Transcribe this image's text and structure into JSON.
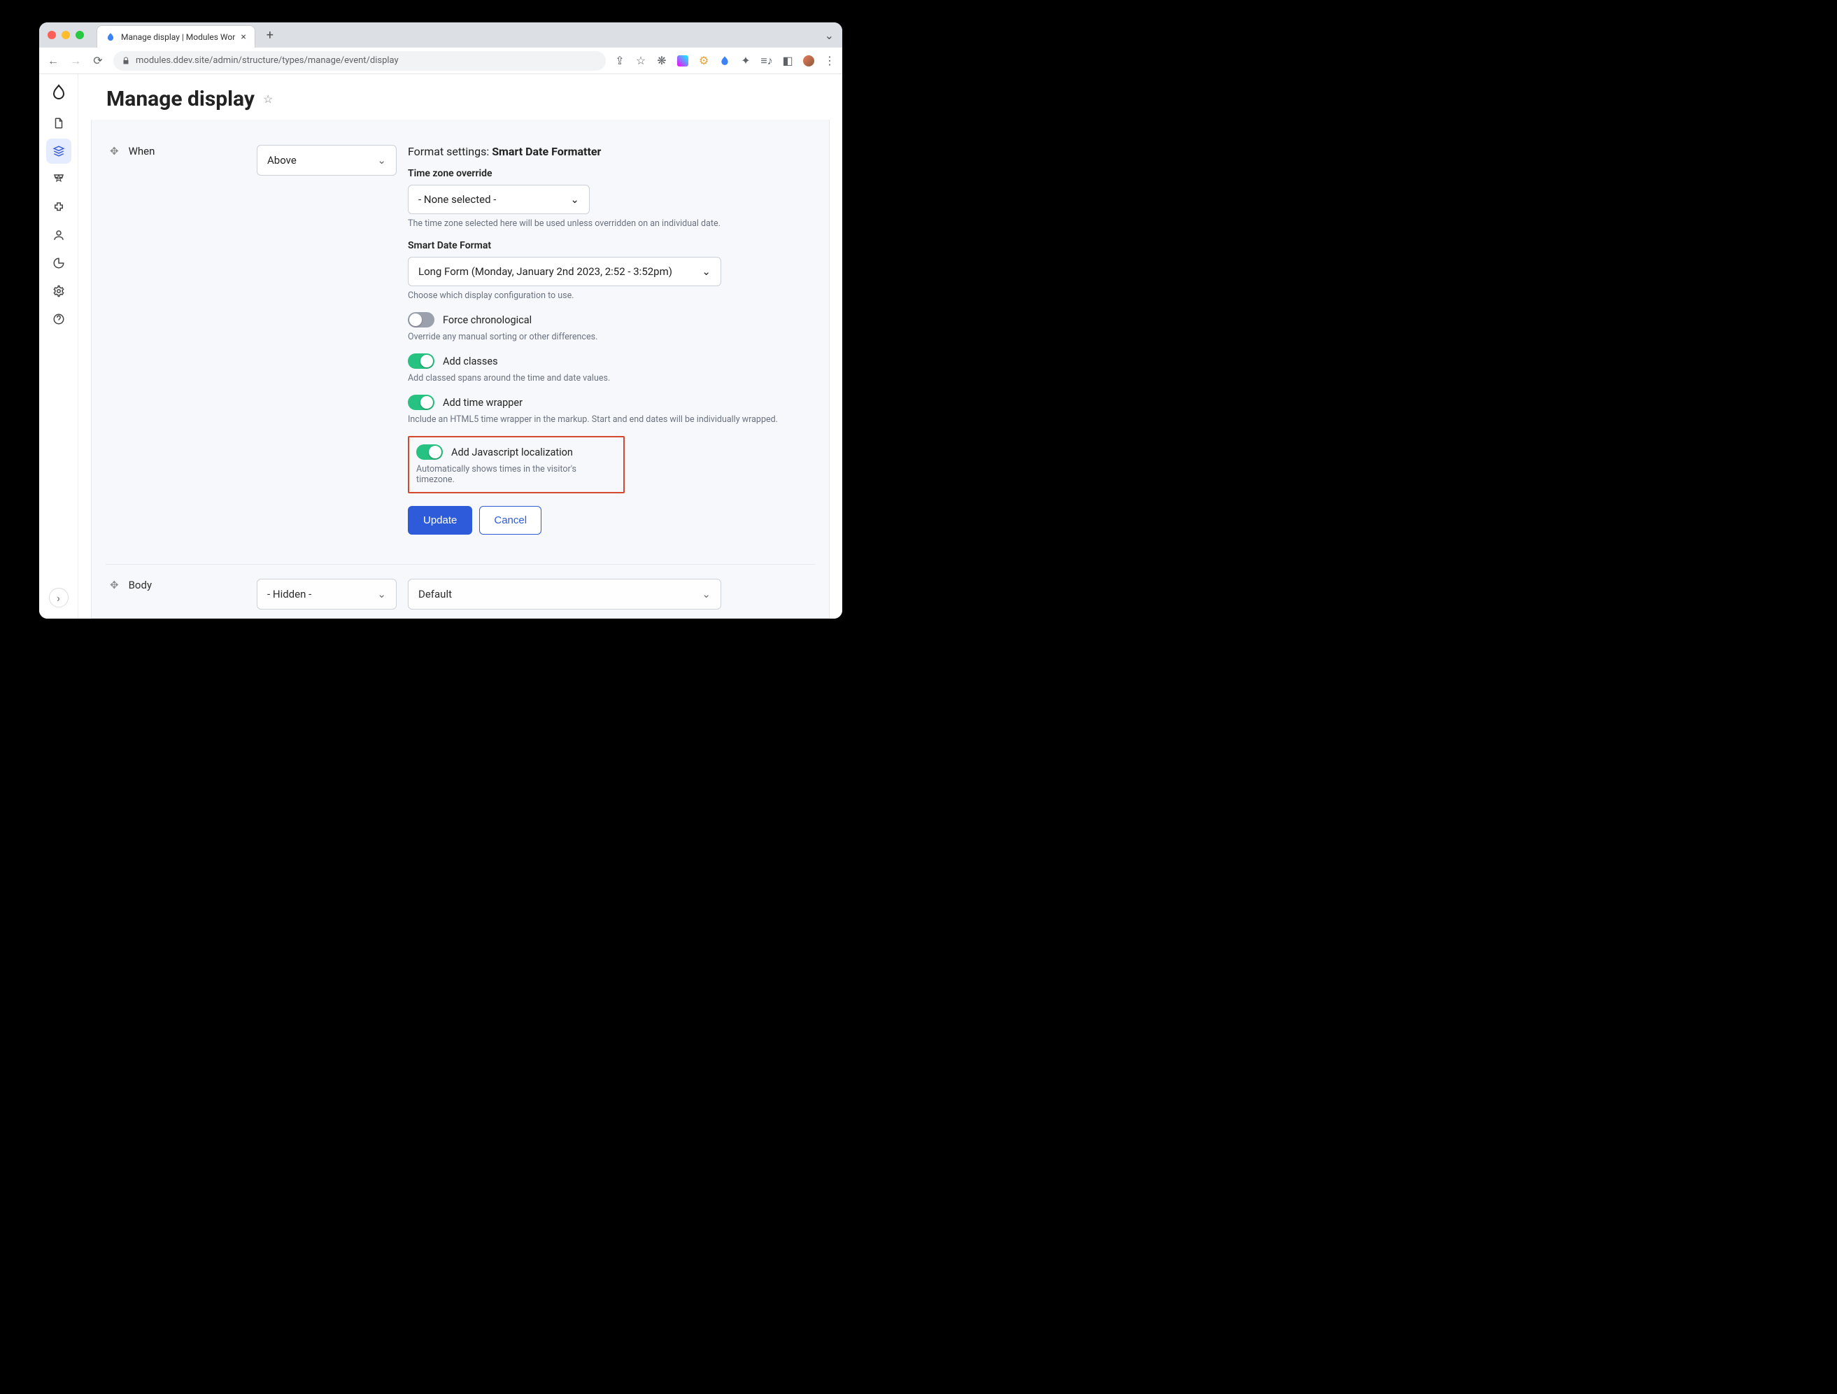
{
  "browser": {
    "tab_title": "Manage display | Modules Wor",
    "url": "modules.ddev.site/admin/structure/types/manage/event/display"
  },
  "page": {
    "title": "Manage display"
  },
  "fields": {
    "when": {
      "label": "When",
      "label_position": "Above",
      "format_settings_prefix": "Format settings:",
      "format_settings_name": "Smart Date Formatter",
      "timezone_label": "Time zone override",
      "timezone_value": "- None selected -",
      "timezone_help": "The time zone selected here will be used unless overridden on an individual date.",
      "format_label": "Smart Date Format",
      "format_value": "Long Form (Monday, January 2nd 2023, 2:52 - 3:52pm)",
      "format_help": "Choose which display configuration to use.",
      "toggles": {
        "force_chrono": {
          "label": "Force chronological",
          "help": "Override any manual sorting or other differences.",
          "on": false
        },
        "add_classes": {
          "label": "Add classes",
          "help": "Add classed spans around the time and date values.",
          "on": true
        },
        "time_wrapper": {
          "label": "Add time wrapper",
          "help": "Include an HTML5 time wrapper in the markup. Start and end dates will be individually wrapped.",
          "on": true
        },
        "js_local": {
          "label": "Add Javascript localization",
          "help": "Automatically shows times in the visitor's timezone.",
          "on": true
        }
      },
      "update": "Update",
      "cancel": "Cancel"
    },
    "body": {
      "label": "Body",
      "label_position": "- Hidden -",
      "format": "Default"
    }
  }
}
